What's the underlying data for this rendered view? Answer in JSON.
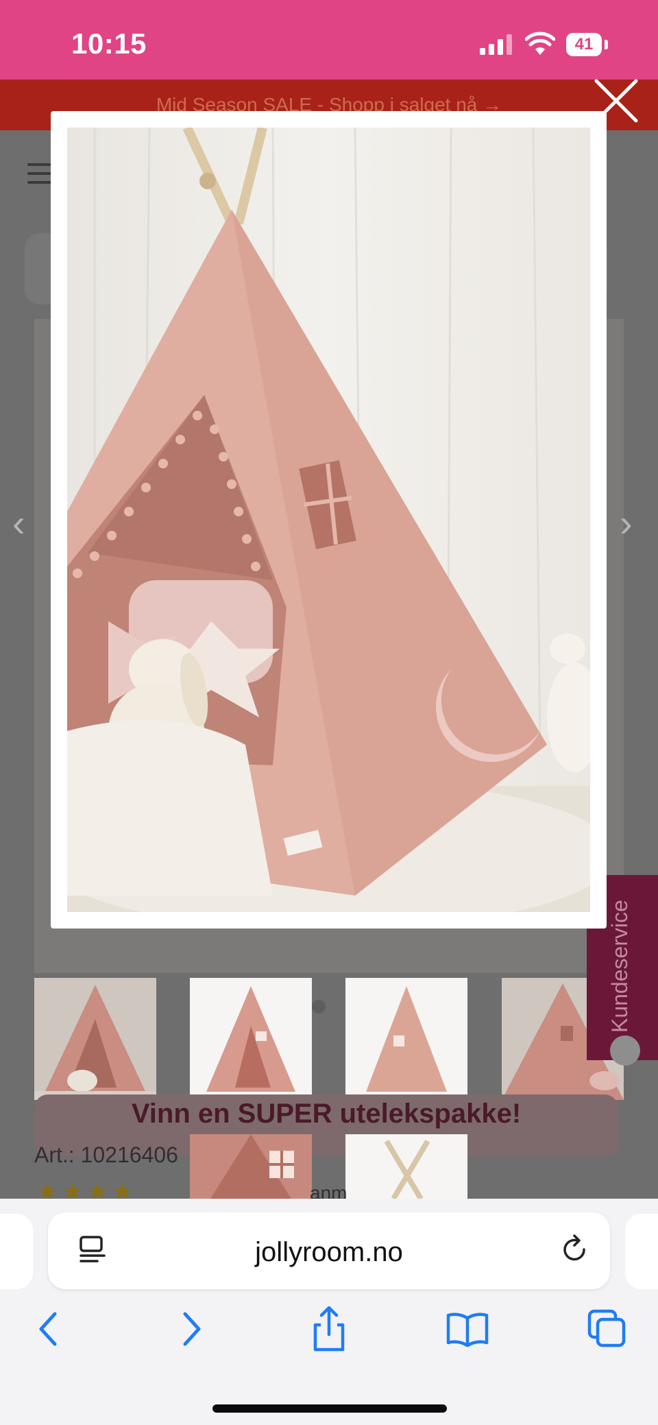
{
  "status_bar": {
    "time": "10:15",
    "battery": "41"
  },
  "page": {
    "promo_banner": "Mid Season SALE - Shopp i salget nå →",
    "side_tab": "Kundeservice",
    "campaign_banner": "Vinn en SUPER utelekspakke!",
    "article_number": "Art.: 10216406",
    "stars": "★★★★",
    "rating_suffix": "anm"
  },
  "lightbox": {
    "image_description_icon": "teepee-tent-photo",
    "close_icon": "close-icon"
  },
  "browser": {
    "url": "jollyroom.no",
    "toolbar": [
      "back-icon",
      "forward-icon",
      "share-icon",
      "bookmarks-icon",
      "tabs-icon"
    ]
  },
  "colors": {
    "status_bar": "#e04484",
    "promo": "#a8221a",
    "accent_blue": "#1f7cf5"
  }
}
